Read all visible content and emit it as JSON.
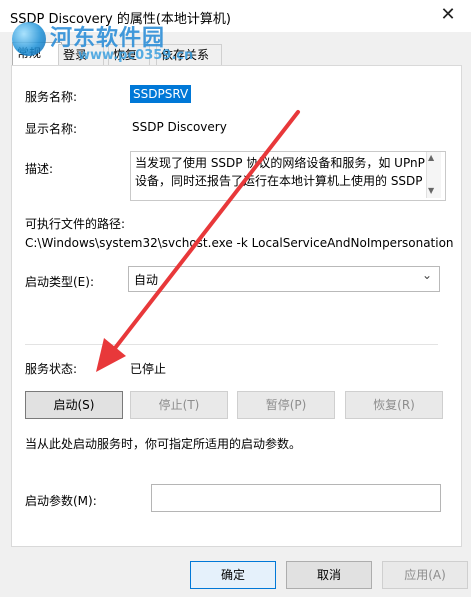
{
  "window": {
    "title": "SSDP Discovery 的属性(本地计算机)",
    "close_glyph": "✕"
  },
  "watermark": {
    "title": "河东软件园",
    "url": "www.pc0359.cn"
  },
  "tabs": [
    {
      "label": "常规"
    },
    {
      "label": "登录"
    },
    {
      "label": "恢复"
    },
    {
      "label": "依存关系"
    }
  ],
  "general": {
    "service_name_label": "服务名称:",
    "service_name_value": "SSDPSRV",
    "display_name_label": "显示名称:",
    "display_name_value": "SSDP Discovery",
    "description_label": "描述:",
    "description_value": "当发现了使用 SSDP 协议的网络设备和服务，如 UPnP 设备，同时还报告了运行在本地计算机上使用的 SSDP",
    "exe_path_label": "可执行文件的路径:",
    "exe_path_value": "C:\\Windows\\system32\\svchost.exe -k LocalServiceAndNoImpersonation",
    "startup_type_label": "启动类型(E):",
    "startup_type_value": "自动",
    "service_status_label": "服务状态:",
    "service_status_value": "已停止",
    "buttons": {
      "start": "启动(S)",
      "stop": "停止(T)",
      "pause": "暂停(P)",
      "resume": "恢复(R)"
    },
    "hint": "当从此处启动服务时，你可指定所适用的启动参数。",
    "start_params_label": "启动参数(M):",
    "start_params_value": ""
  },
  "footer": {
    "ok": "确定",
    "cancel": "取消",
    "apply": "应用(A)"
  },
  "colors": {
    "selection": "#0078d7",
    "annotation_arrow": "#e8383a"
  }
}
